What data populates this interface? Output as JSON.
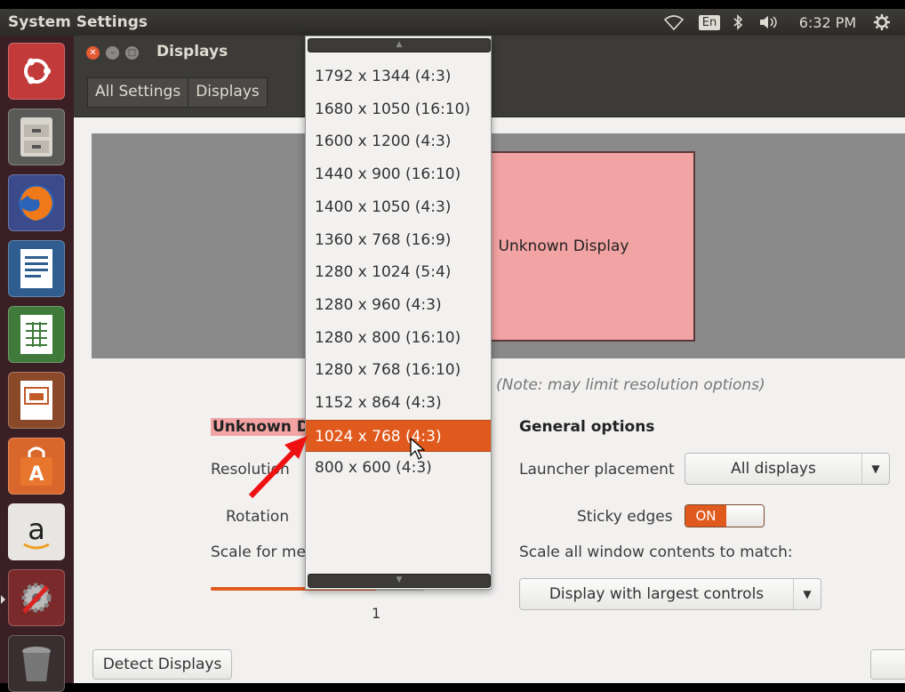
{
  "topbar": {
    "app_title": "System Settings",
    "keyboard_layout": "En",
    "clock": "6:32 PM",
    "icons": [
      "wifi-icon",
      "keyboard-layout-icon",
      "bluetooth-icon",
      "volume-icon",
      "system-gear-icon"
    ]
  },
  "launcher": {
    "items": [
      "ubuntu-dash",
      "files",
      "firefox",
      "libreoffice-writer",
      "libreoffice-calc",
      "libreoffice-impress",
      "ubuntu-software-center",
      "amazon",
      "system-settings",
      "trash"
    ]
  },
  "window": {
    "title": "Displays",
    "breadcrumb": [
      "All Settings",
      "Displays"
    ]
  },
  "preview": {
    "display_name": "Unknown Display"
  },
  "note": "(Note: may limit resolution options)",
  "monitor_section": {
    "heading": "Unknown Di",
    "resolution_label": "Resolution",
    "rotation_label": "Rotation",
    "scale_label": "Scale for me",
    "scale_value": "1",
    "scale_fraction": 0.78
  },
  "general": {
    "heading": "General options",
    "launcher_label": "Launcher placement",
    "launcher_value": "All displays",
    "sticky_label": "Sticky edges",
    "sticky_value": "ON",
    "scale_all_label": "Scale all window contents to match:",
    "scale_all_value": "Display with largest controls"
  },
  "buttons": {
    "detect": "Detect Displays"
  },
  "resolution_popup": {
    "options": [
      "1792 x 1344 (4:3)",
      "1680 x 1050 (16:10)",
      "1600 x 1200 (4:3)",
      "1440 x 900 (16:10)",
      "1400 x 1050 (4:3)",
      "1360 x 768 (16:9)",
      "1280 x 1024 (5:4)",
      "1280 x 960 (4:3)",
      "1280 x 800 (16:10)",
      "1280 x 768 (16:10)",
      "1152 x 864 (4:3)",
      "1024 x 768 (4:3)",
      "800 x 600 (4:3)"
    ],
    "selected_index": 11
  },
  "colors": {
    "accent": "#e05a1d",
    "panel": "#3c3b37",
    "launcher": "#3a1f25",
    "monitor": "#f2a3a3",
    "annotation_arrow": "#ee1111"
  }
}
